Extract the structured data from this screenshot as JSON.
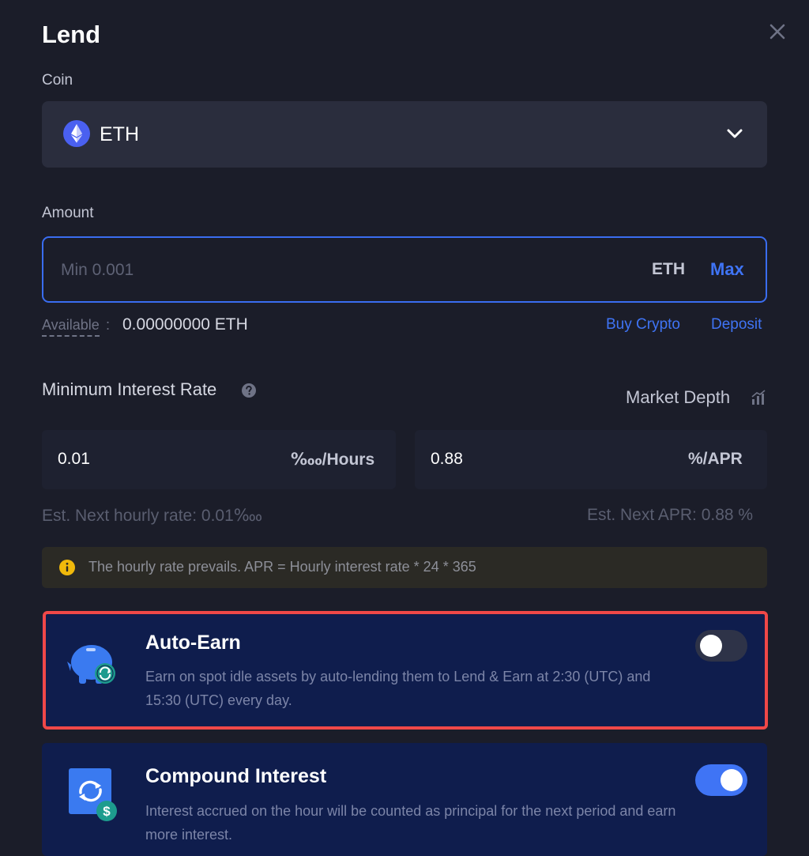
{
  "modal": {
    "title": "Lend"
  },
  "coin": {
    "label": "Coin",
    "selected": "ETH"
  },
  "amount": {
    "label": "Amount",
    "placeholder": "Min 0.001",
    "value": "",
    "unit": "ETH",
    "max_label": "Max",
    "available_label": "Available",
    "available_colon": ":",
    "available_value": "0.00000000 ETH",
    "buy_crypto_label": "Buy Crypto",
    "deposit_label": "Deposit"
  },
  "interest": {
    "label": "Minimum Interest Rate",
    "market_depth_label": "Market Depth",
    "hourly_value": "0.01",
    "hourly_unit": "‱/Hours",
    "apr_value": "0.88",
    "apr_unit": "%/APR",
    "est_hourly": "Est. Next hourly rate: 0.01‱",
    "est_apr": "Est. Next APR: 0.88 %",
    "info_text": "The hourly rate prevails. APR = Hourly interest rate * 24 * 365"
  },
  "auto_earn": {
    "title": "Auto-Earn",
    "description": "Earn on spot idle assets by auto-lending them to Lend & Earn at 2:30 (UTC) and 15:30 (UTC) every day.",
    "enabled": false
  },
  "compound": {
    "title": "Compound Interest",
    "description": "Interest accrued on the hour will be counted as principal for the next period and earn more interest.",
    "enabled": true
  },
  "colors": {
    "background": "#1b1d29",
    "accent": "#3f74f5",
    "card": "#0f1d4d",
    "highlight": "#ef4848",
    "warning": "#f0b90b"
  }
}
